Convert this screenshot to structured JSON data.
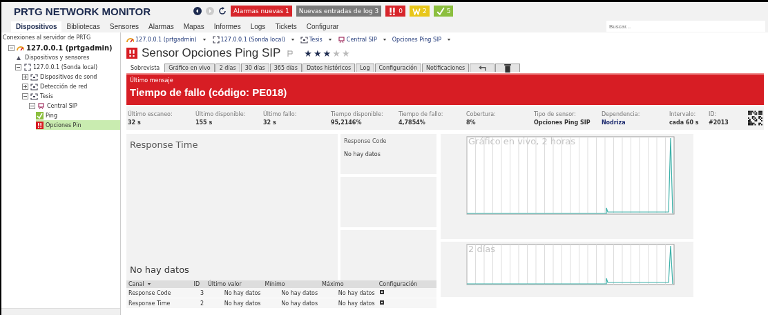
{
  "header": {
    "logo": "PRTG NETWORK MONITOR",
    "badges": [
      {
        "kind": "text",
        "label": "Alarmas nuevas 1",
        "color": "#d7252b"
      },
      {
        "kind": "text",
        "label": "Nuevas entradas de log 3",
        "color": "#7a7a7a"
      },
      {
        "kind": "down",
        "label": "0",
        "color": "#d7252b"
      },
      {
        "kind": "warning",
        "label": "2",
        "color": "#e8c619"
      },
      {
        "kind": "up",
        "label": "5",
        "color": "#8cbf3f"
      }
    ]
  },
  "nav": {
    "tabs": [
      {
        "label": "Dispositivos",
        "selected": true
      },
      {
        "label": "Bibliotecas",
        "selected": false
      },
      {
        "label": "Sensores",
        "selected": false
      },
      {
        "label": "Alarmas",
        "selected": false
      },
      {
        "label": "Mapas",
        "selected": false
      },
      {
        "label": "Informes",
        "selected": false
      },
      {
        "label": "Logs",
        "selected": false
      },
      {
        "label": "Tickets",
        "selected": false
      },
      {
        "label": "Configurar",
        "selected": false
      }
    ],
    "search": {
      "placeholder": "Buscar..."
    }
  },
  "sidebar": {
    "title": "Conexiones al servidor de PRTG",
    "tree": [
      {
        "label": "127.0.0.1 (prtgadmin)",
        "kind": "server",
        "expanded": true,
        "selected": false,
        "children": [
          {
            "label": "Dispositivos y sensores",
            "kind": "plain",
            "selected": false
          },
          {
            "label": "127.0.0.1 (Sonda local)",
            "kind": "probe",
            "expanded": true,
            "selected": false,
            "children": [
              {
                "label": "Dispositivos de sond",
                "kind": "group",
                "expanded": false,
                "selected": false
              },
              {
                "label": "Detección de red",
                "kind": "group",
                "expanded": false,
                "selected": false
              },
              {
                "label": "Tesis",
                "kind": "group",
                "expanded": true,
                "selected": false,
                "children": [
                  {
                    "label": "Central SIP",
                    "kind": "device",
                    "expanded": true,
                    "selected": false,
                    "children": [
                      {
                        "label": "Ping",
                        "kind": "sensor-up",
                        "selected": false
                      },
                      {
                        "label": "Opciones Pin",
                        "kind": "sensor-down",
                        "selected": true
                      }
                    ]
                  }
                ]
              }
            ]
          }
        ]
      }
    ]
  },
  "breadcrumbs": [
    {
      "label": "127.0.0.1 (prtgadmin)",
      "kind": "server"
    },
    {
      "label": "127.0.0.1 (Sonda local)",
      "kind": "probe"
    },
    {
      "label": "Tesis",
      "kind": "group"
    },
    {
      "label": "Central SIP",
      "kind": "device"
    },
    {
      "label": "Opciones Ping SIP",
      "kind": "sensor"
    }
  ],
  "sensor": {
    "title": "Sensor Opciones Ping SIP",
    "stars": 3
  },
  "tabs": [
    {
      "kind": "text",
      "label": "Sobrevista",
      "selected": true
    },
    {
      "kind": "text",
      "label": "Gráfico en vivo",
      "selected": false
    },
    {
      "kind": "text",
      "label": "2 días",
      "selected": false
    },
    {
      "kind": "text",
      "label": "30 días",
      "selected": false
    },
    {
      "kind": "text",
      "label": "365 días",
      "selected": false
    },
    {
      "kind": "text",
      "label": "Datos históricos",
      "selected": false
    },
    {
      "kind": "text",
      "label": "Log",
      "selected": false
    },
    {
      "kind": "text",
      "label": "Configuración",
      "selected": false
    },
    {
      "kind": "text",
      "label": "Notificaciones",
      "selected": false
    },
    {
      "kind": "back",
      "selected": false
    },
    {
      "kind": "delete",
      "selected": false
    }
  ],
  "message": {
    "label": "Último mensaje",
    "text": "Tiempo de fallo (código: PE018)"
  },
  "stats": [
    {
      "label": "Último escaneo:",
      "value": "32 s"
    },
    {
      "label": "Último disponible:",
      "value": "155 s"
    },
    {
      "label": "Último fallo:",
      "value": "32 s"
    },
    {
      "label": "Tiempo disponible:",
      "value": "95,2146%"
    },
    {
      "label": "Tiempo de fallo:",
      "value": "4,7854%"
    },
    {
      "label": "Cobertura:",
      "value": "8%"
    },
    {
      "label": "Tipo de sensor:",
      "value": "Opciones Ping SIP"
    },
    {
      "label": "Dependencia:",
      "value": "Nodriza"
    },
    {
      "label": "Intervalo:",
      "value": "cada 60 s"
    },
    {
      "label": "ID:",
      "value": "#2013"
    }
  ],
  "gauges": {
    "main": {
      "title": "Response Time",
      "text": "No hay datos"
    },
    "side": {
      "title": "Response Code",
      "text": "No hay datos"
    }
  },
  "channels": {
    "columns": [
      "Canal",
      "ID",
      "Último valor",
      "Mínimo",
      "Máximo",
      "Configuración"
    ],
    "rows": [
      {
        "name": "Response Code",
        "id": "3",
        "last": "No hay datos",
        "min": "No hay datos",
        "max": "No hay datos"
      },
      {
        "name": "Response Time",
        "id": "2",
        "last": "No hay datos",
        "min": "No hay datos",
        "max": "No hay datos"
      }
    ]
  },
  "graphs": [
    {
      "title": "Gráfico en vivo, 2 horas",
      "kind": "live"
    },
    {
      "title": "2 días",
      "kind": "days"
    }
  ]
}
